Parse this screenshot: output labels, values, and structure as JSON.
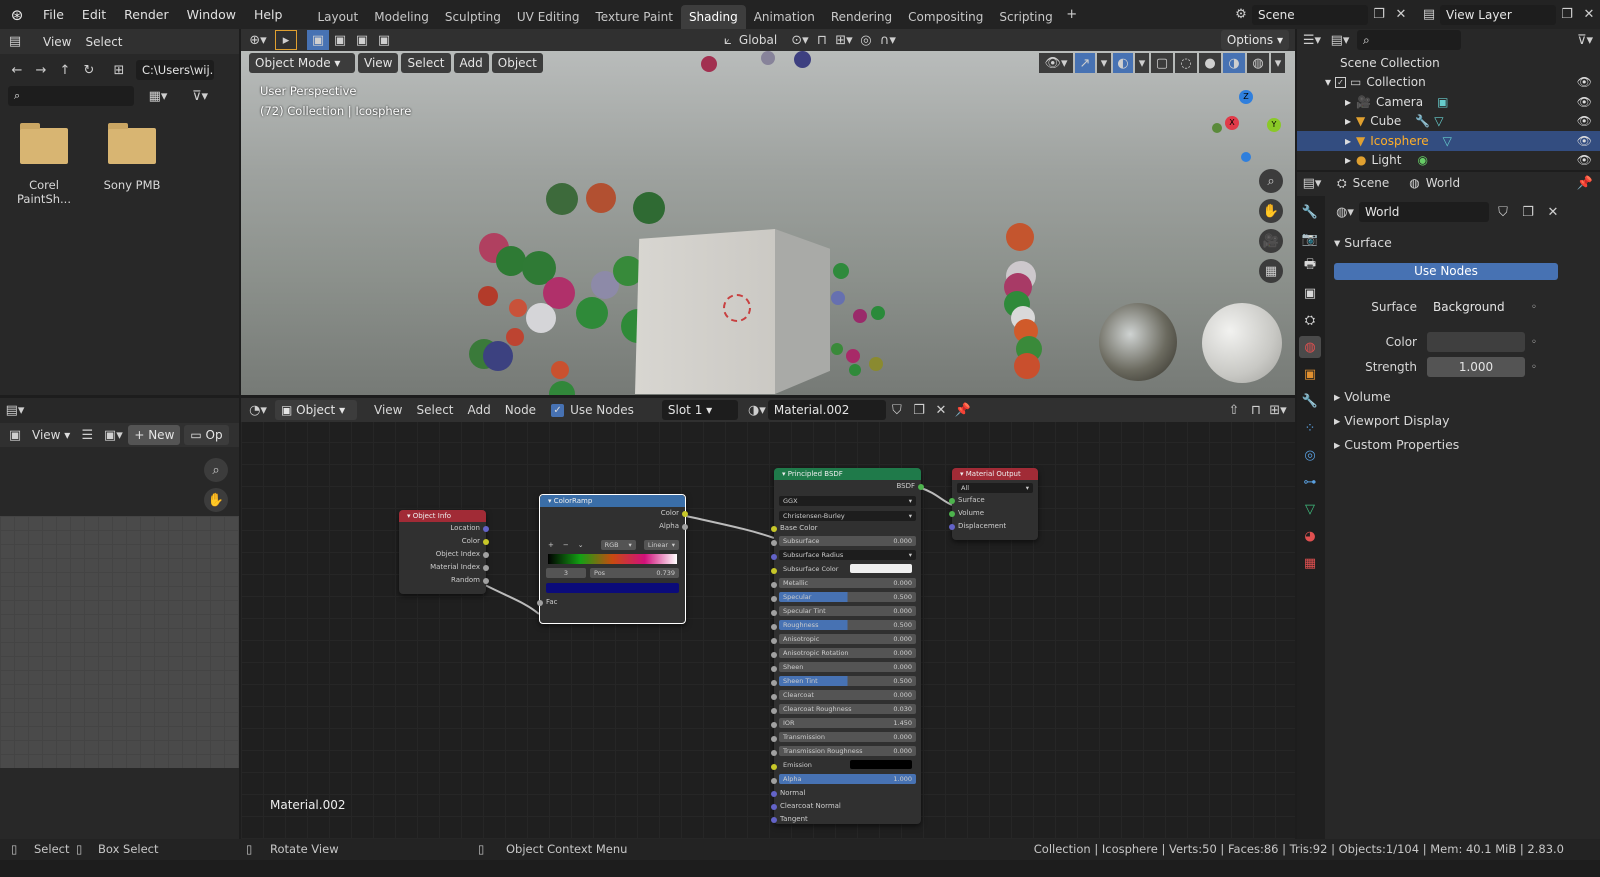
{
  "topbar": {
    "menus": [
      "File",
      "Edit",
      "Render",
      "Window",
      "Help"
    ],
    "workspaces": [
      "Layout",
      "Modeling",
      "Sculpting",
      "UV Editing",
      "Texture Paint",
      "Shading",
      "Animation",
      "Rendering",
      "Compositing",
      "Scripting"
    ],
    "active_workspace": "Shading",
    "scene": "Scene",
    "view_layer": "View Layer"
  },
  "filebrowser": {
    "menus": [
      "View",
      "Select"
    ],
    "path": "C:\\Users\\wij...",
    "folders": [
      "Corel PaintSh...",
      "Sony PMB"
    ]
  },
  "viewport": {
    "mode": "Object Mode",
    "menus": [
      "View",
      "Select",
      "Add",
      "Object"
    ],
    "orientation": "Global",
    "options": "Options",
    "perspective": "User Perspective",
    "context": "(72) Collection | Icosphere",
    "gizmo": {
      "x": "X",
      "y": "Y",
      "z": "Z"
    }
  },
  "imageeditor": {
    "view": "View",
    "new": "New",
    "open_trunc": "Op"
  },
  "nodeeditor": {
    "type": "Object",
    "menus": [
      "View",
      "Select",
      "Add",
      "Node"
    ],
    "use_nodes": "Use Nodes",
    "slot": "Slot 1",
    "material": "Material.002",
    "footer_label": "Material.002",
    "object_info": {
      "title": "Object Info",
      "outputs": [
        "Location",
        "Color",
        "Object Index",
        "Material Index",
        "Random"
      ]
    },
    "colorramp": {
      "title": "ColorRamp",
      "outputs": [
        "Color",
        "Alpha"
      ],
      "mode": "RGB",
      "interp": "Linear",
      "index": "3",
      "pos_label": "Pos",
      "pos_value": "0.739",
      "input": "Fac",
      "active_color": "#0b0b7a"
    },
    "bsdf": {
      "title": "Principled BSDF",
      "output": "BSDF",
      "distribution": "GGX",
      "subsurface_method": "Christensen-Burley",
      "base_color": "Base Color",
      "fields": [
        {
          "label": "Subsurface",
          "value": "0.000"
        },
        {
          "label": "Subsurface Radius",
          "value": ""
        },
        {
          "label": "Subsurface Color",
          "value": ""
        },
        {
          "label": "Metallic",
          "value": "0.000"
        },
        {
          "label": "Specular",
          "value": "0.500"
        },
        {
          "label": "Specular Tint",
          "value": "0.000"
        },
        {
          "label": "Roughness",
          "value": "0.500"
        },
        {
          "label": "Anisotropic",
          "value": "0.000"
        },
        {
          "label": "Anisotropic Rotation",
          "value": "0.000"
        },
        {
          "label": "Sheen",
          "value": "0.000"
        },
        {
          "label": "Sheen Tint",
          "value": "0.500"
        },
        {
          "label": "Clearcoat",
          "value": "0.000"
        },
        {
          "label": "Clearcoat Roughness",
          "value": "0.030"
        },
        {
          "label": "IOR",
          "value": "1.450"
        },
        {
          "label": "Transmission",
          "value": "0.000"
        },
        {
          "label": "Transmission Roughness",
          "value": "0.000"
        },
        {
          "label": "Emission",
          "value": ""
        },
        {
          "label": "Alpha",
          "value": "1.000"
        }
      ],
      "inputs_tail": [
        "Normal",
        "Clearcoat Normal",
        "Tangent"
      ]
    },
    "material_output": {
      "title": "Material Output",
      "target": "All",
      "inputs": [
        "Surface",
        "Volume",
        "Displacement"
      ]
    }
  },
  "outliner": {
    "root": "Scene Collection",
    "items": [
      {
        "name": "Collection",
        "selected": false
      },
      {
        "name": "Camera",
        "selected": false
      },
      {
        "name": "Cube",
        "selected": false
      },
      {
        "name": "Icosphere",
        "selected": true
      },
      {
        "name": "Light",
        "selected": false
      }
    ]
  },
  "properties": {
    "breadcrumb_scene": "Scene",
    "breadcrumb_world": "World",
    "world_name": "World",
    "surface_panel": "Surface",
    "use_nodes": "Use Nodes",
    "surface_label": "Surface",
    "surface_value": "Background",
    "color_label": "Color",
    "strength_label": "Strength",
    "strength_value": "1.000",
    "panels": [
      "Volume",
      "Viewport Display",
      "Custom Properties"
    ]
  },
  "statusbar": {
    "select": "Select",
    "box_select": "Box Select",
    "rotate": "Rotate View",
    "context_menu": "Object Context Menu",
    "stats": "Collection | Icosphere | Verts:50 | Faces:86 | Tris:92 | Objects:1/104 | Mem: 40.1 MiB | 2.83.0"
  },
  "colors": {
    "accent": "#4772b3",
    "selected_row": "#334d80",
    "object_info_header": "#a12b36",
    "colorramp_header": "#3a6ea8",
    "bsdf_header": "#1f7a4a",
    "output_header": "#a12b36"
  },
  "icons": [
    "blender-logo-icon",
    "search-icon",
    "filter-icon",
    "folder-icon",
    "zoom-icon",
    "hand-icon",
    "camera-icon",
    "grid-icon",
    "eye-icon",
    "world-icon",
    "wrench-icon",
    "pin-icon"
  ]
}
